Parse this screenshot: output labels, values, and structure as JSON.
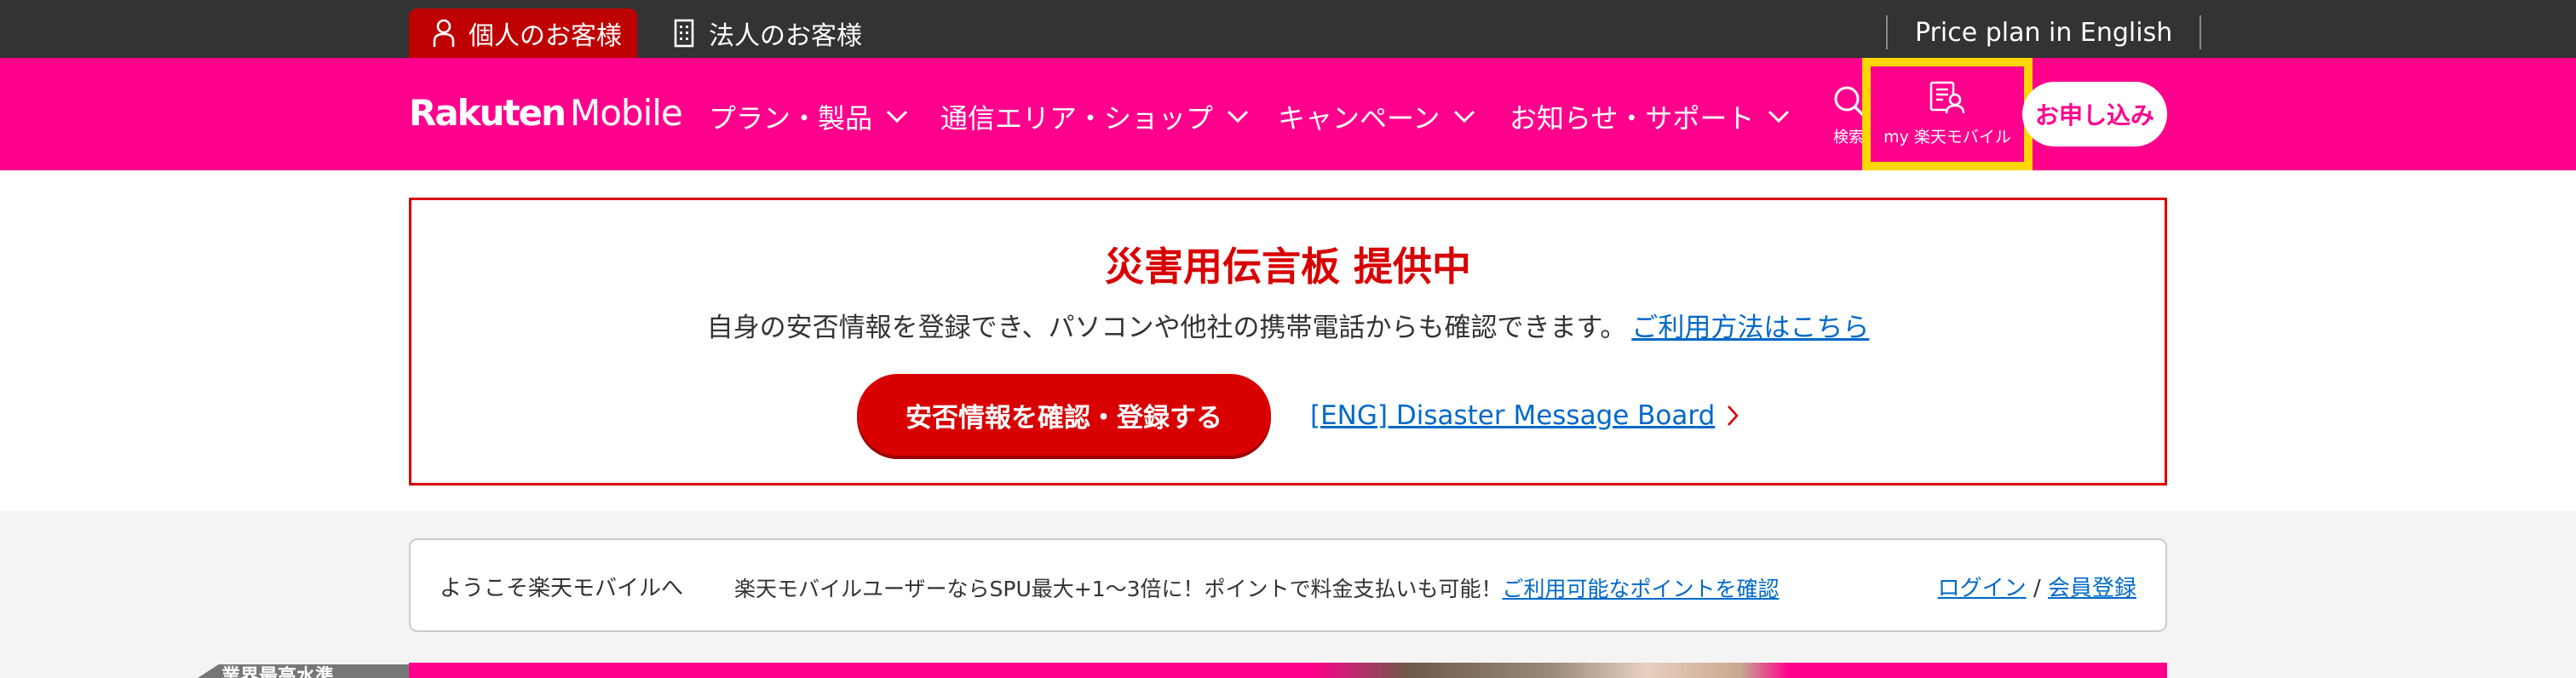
{
  "topbar": {
    "tab_personal": "個人のお客様",
    "tab_corporate": "法人のお客様",
    "price_english": "Price plan in English"
  },
  "nav": {
    "logo_bold": "Rakuten",
    "logo_light": "Mobile",
    "items": [
      {
        "label": "プラン・製品"
      },
      {
        "label": "通信エリア・ショップ"
      },
      {
        "label": "キャンペーン"
      },
      {
        "label": "お知らせ・サポート"
      }
    ],
    "search_label": "検索",
    "mypage_label": "my 楽天モバイル",
    "apply_label": "お申し込み"
  },
  "alert": {
    "title": "災害用伝言板 提供中",
    "description": "自身の安否情報を登録でき、パソコンや他社の携帯電話からも確認できます。",
    "howto_link": "ご利用方法はこちら",
    "button_label": "安否情報を確認・登録する",
    "english_link": "[ENG] Disaster Message Board"
  },
  "welcome": {
    "greeting": "ようこそ楽天モバイルへ",
    "message": "楽天モバイルユーザーならSPU最大+1〜3倍に！ポイントで料金支払いも可能！",
    "points_link": "ご利用可能なポイントを確認",
    "login_link": "ログイン",
    "separator": "/",
    "register_link": "会員登録"
  },
  "side_tag": "業界最高水準",
  "colors": {
    "brand_pink": "#ff008c",
    "alert_red": "#d80000",
    "dark_bar": "#333333",
    "link_blue": "#0069c8",
    "highlight_yellow": "#ffd700"
  }
}
